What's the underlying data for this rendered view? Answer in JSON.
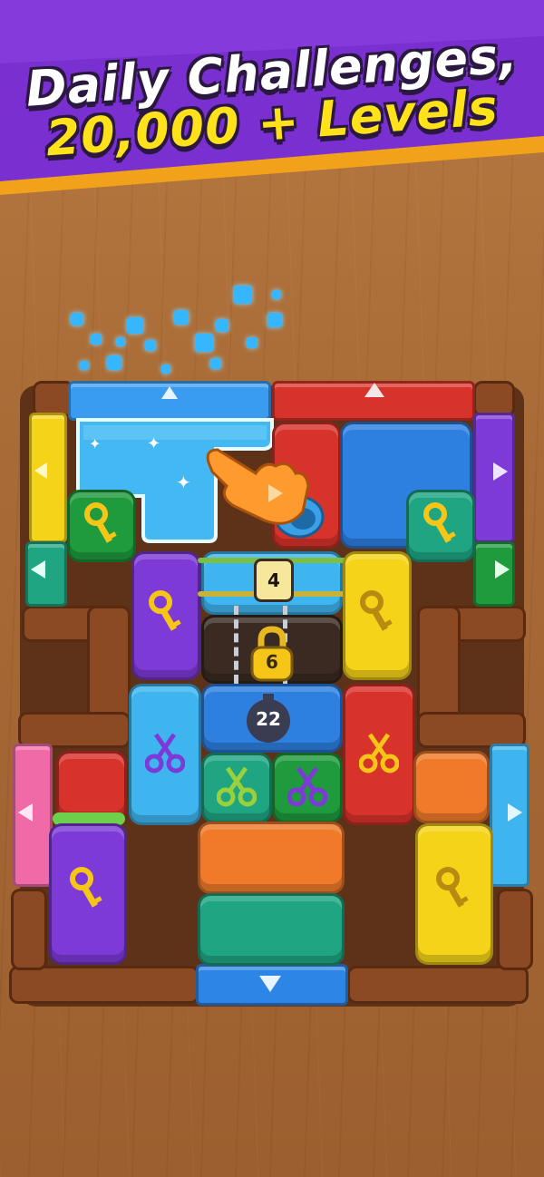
{
  "banner": {
    "line1": "Daily Challenges,",
    "line2": "20,000 + Levels"
  },
  "counters": {
    "rope_hits": "4",
    "lock_count": "6",
    "bomb_timer": "22"
  },
  "colors": {
    "banner_purple": "#7a2fd0",
    "banner_gold": "#f2a21a",
    "wood": "#a86a36",
    "block_blue": "#2d86e6",
    "block_red": "#d8332a",
    "block_yellow": "#f5d319",
    "block_purple": "#7d3ad6",
    "block_green": "#1f9a3c",
    "block_teal": "#1fa582",
    "block_orange": "#f07a2a",
    "block_sky": "#3fb5f0"
  },
  "icons": [
    "key-icon",
    "scissors-icon",
    "lock-icon",
    "bomb-icon",
    "arrow-icon",
    "pointer-hand-icon"
  ]
}
